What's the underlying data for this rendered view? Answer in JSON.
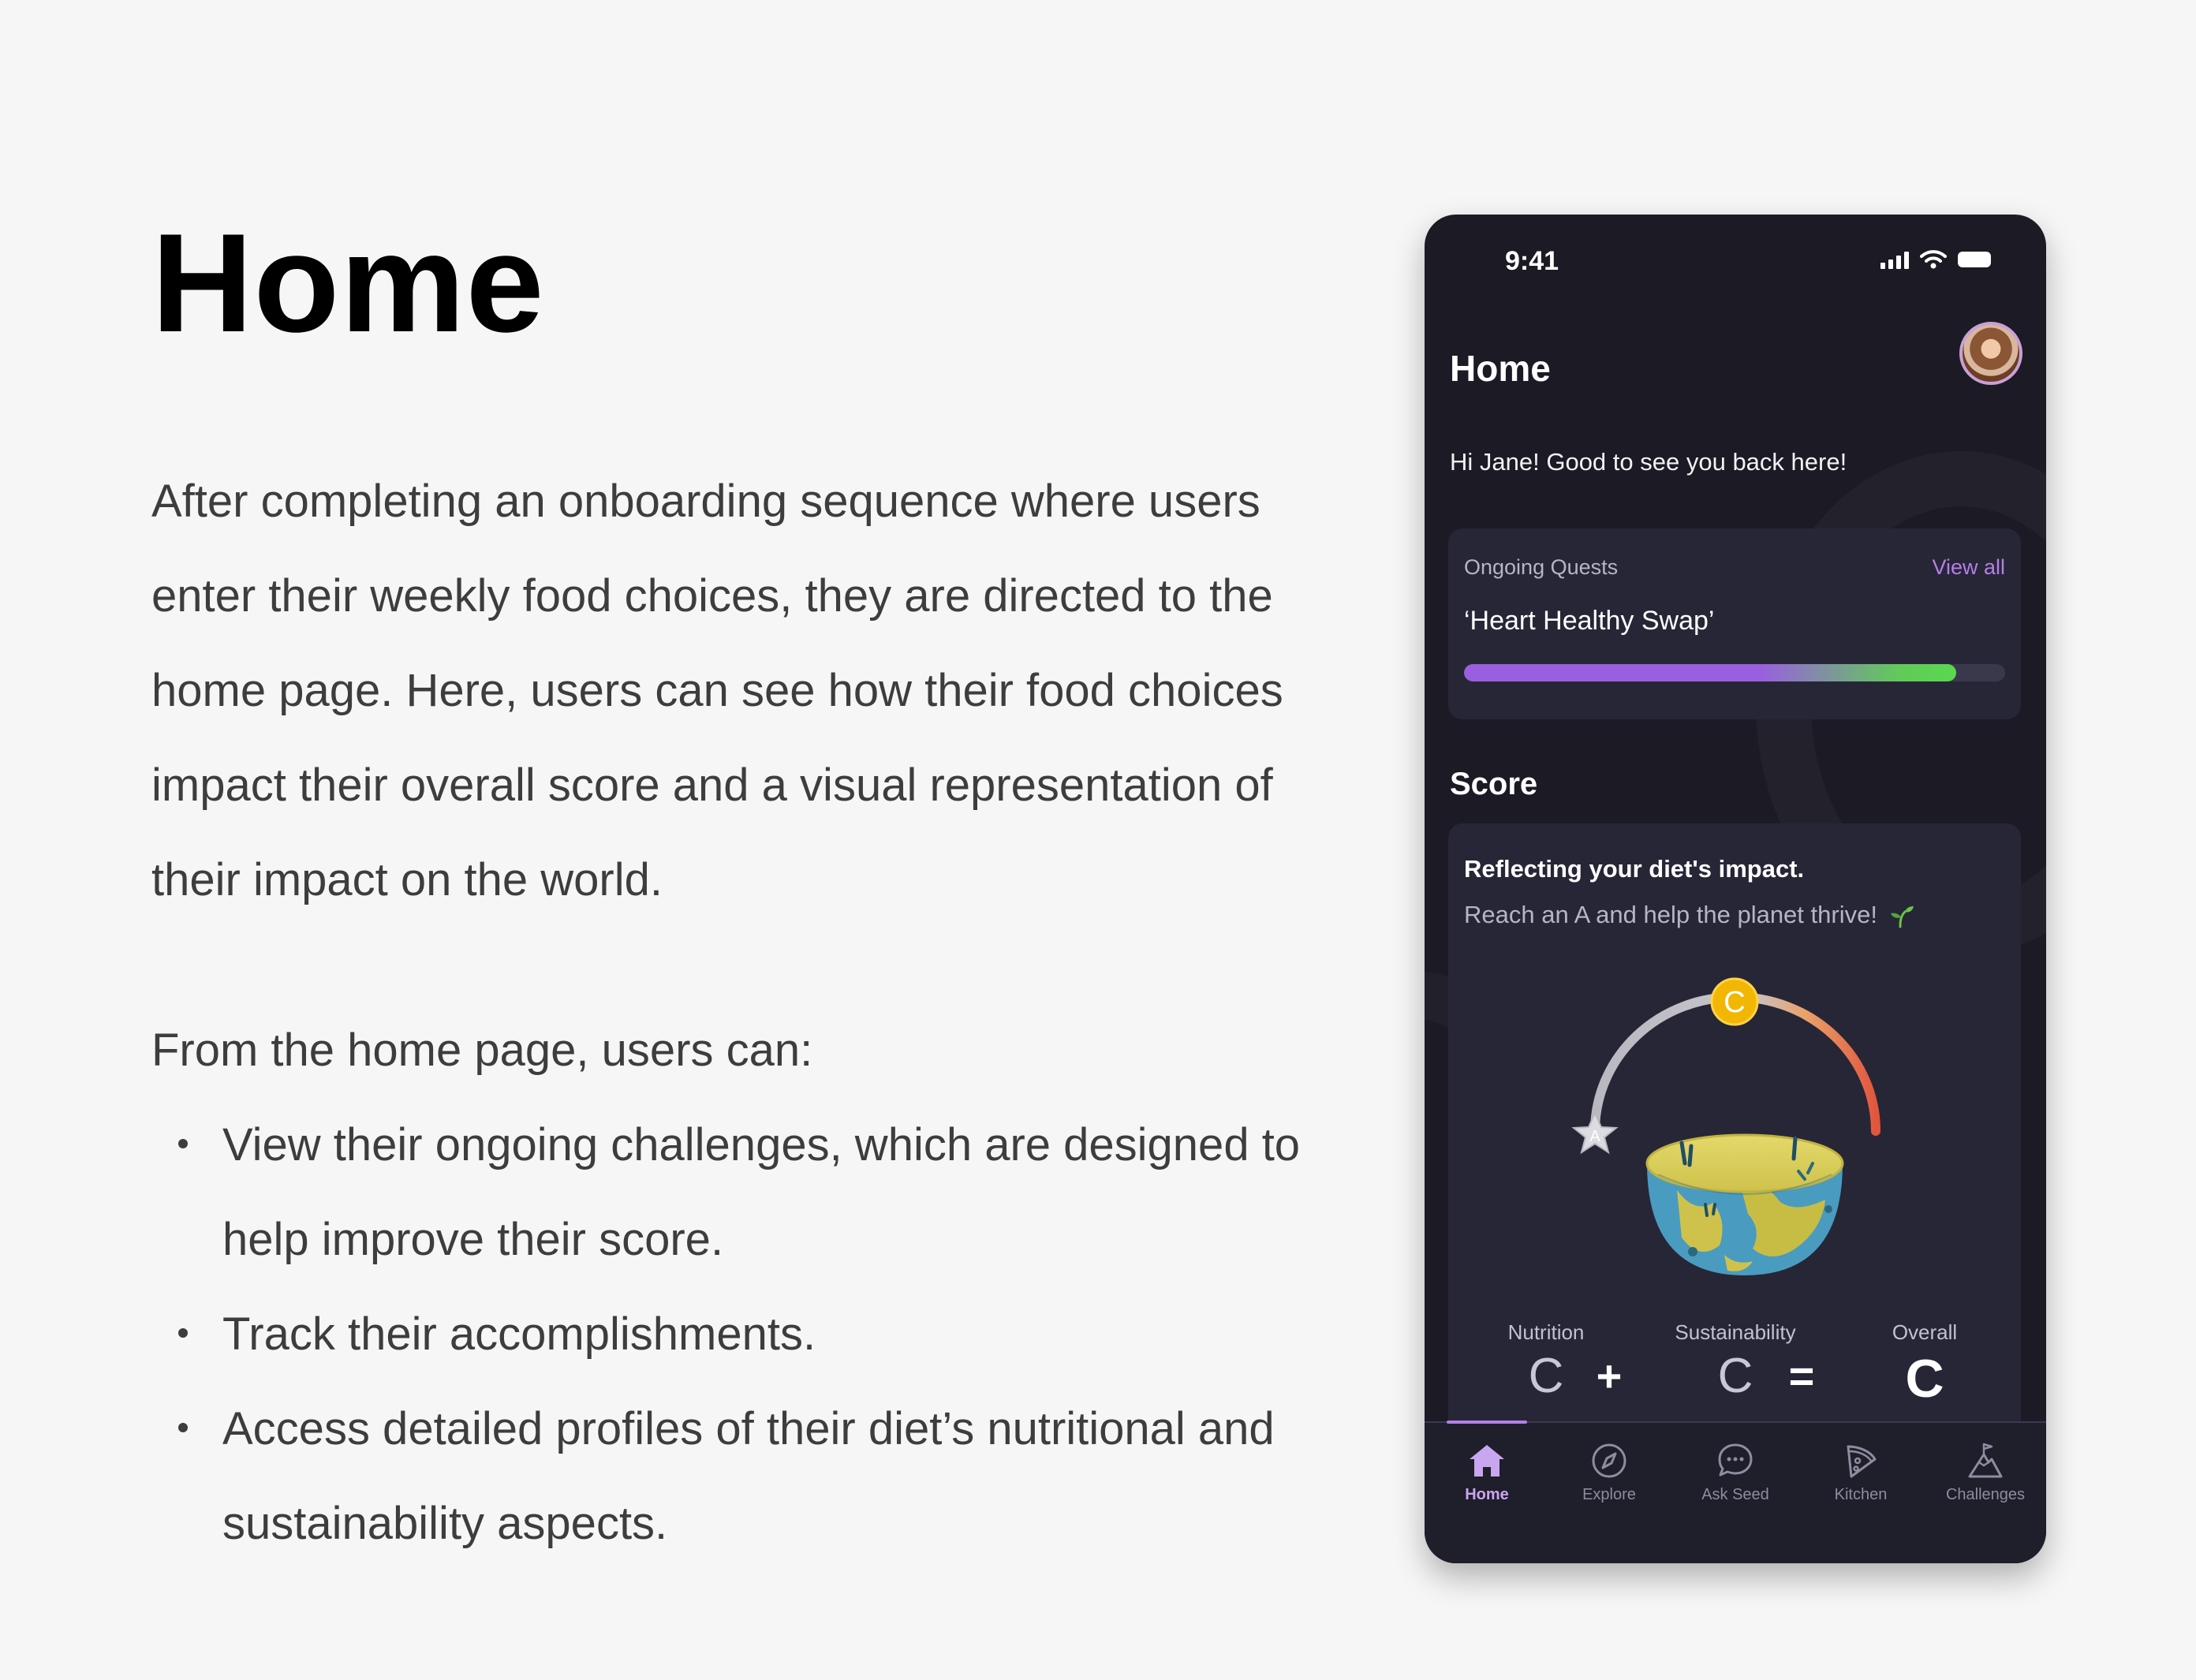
{
  "slide": {
    "heading": "Home",
    "paragraph": "After completing an onboarding sequence where users enter their weekly food choices, they are directed to the home page. Here, users can see how their food choices impact their overall score and a visual representation of their impact on the world.",
    "list_intro": "From the home page, users can:",
    "bullets": [
      "View their ongoing challenges, which are designed to help improve their score.",
      "Track their accomplishments.",
      "Access detailed profiles of their diet’s nutritional and sustainability aspects."
    ]
  },
  "phone": {
    "status": {
      "time": "9:41"
    },
    "title": "Home",
    "greeting": "Hi Jane! Good to see you back here!",
    "quests": {
      "label": "Ongoing Quests",
      "view_all": "View all",
      "name": "‘Heart Healthy Swap’",
      "progress": 0.91
    },
    "score": {
      "heading": "Score",
      "subtitle": "Reflecting your diet's impact.",
      "tagline": "Reach an A and help the planet thrive!",
      "gauge_current_grade": "C",
      "gauge_target_grade": "A",
      "metrics": [
        {
          "label": "Nutrition",
          "grade": "C"
        },
        {
          "label": "Sustainability",
          "grade": "C"
        },
        {
          "label": "Overall",
          "grade": "C"
        }
      ],
      "operators": [
        "+",
        "="
      ]
    },
    "tabs": [
      {
        "label": "Home",
        "icon": "home-icon",
        "active": true
      },
      {
        "label": "Explore",
        "icon": "compass-icon",
        "active": false
      },
      {
        "label": "Ask Seed",
        "icon": "chat-bubble-icon",
        "active": false
      },
      {
        "label": "Kitchen",
        "icon": "pizza-slice-icon",
        "active": false
      },
      {
        "label": "Challenges",
        "icon": "mountain-flag-icon",
        "active": false
      }
    ],
    "colors": {
      "background": "#1b1a25",
      "card": "#272636",
      "accent": "#b57ee8",
      "progress_start": "#9a5fe0",
      "progress_end": "#5ad84f",
      "grade_badge": "#f2b705"
    }
  }
}
